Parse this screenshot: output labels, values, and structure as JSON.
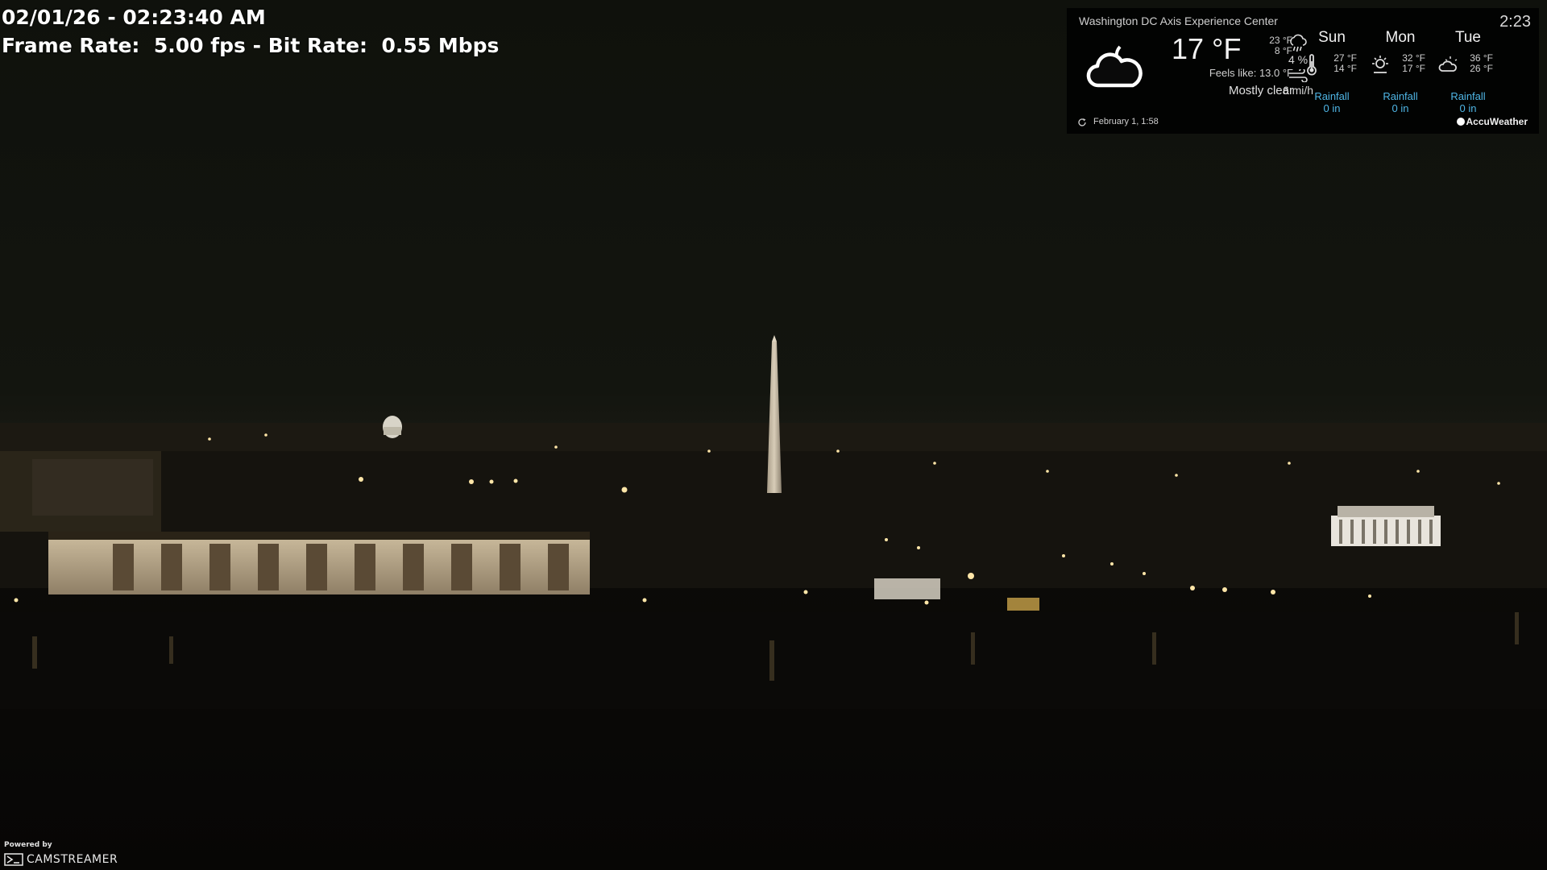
{
  "stream": {
    "datetime": "02/01/26 - 02:23:40 AM",
    "frame_rate_label": "Frame Rate:",
    "frame_rate_value": "5.00 fps",
    "bit_rate_label": "Bit Rate:",
    "bit_rate_value": "0.55 Mbps",
    "separator": "-"
  },
  "weather": {
    "location": "Washington DC Axis Experience Center",
    "time": "2:23",
    "current_icon": "partly-cloudy-night-icon",
    "temperature": "17 °F",
    "high": "23 °F",
    "low": "8 °F",
    "feels_like": "Feels like: 13.0 °F",
    "condition": "Mostly clear",
    "precip_icon": "rain-cloud-icon",
    "precipitation": "4 %",
    "wind_icon": "wind-icon",
    "wind": "6 mi/h",
    "forecast": [
      {
        "day": "Sun",
        "icon": "thermometer-icon",
        "high": "27 °F",
        "low": "14 °F",
        "rain_label": "Rainfall",
        "rain": "0 in"
      },
      {
        "day": "Mon",
        "icon": "sun-cloud-icon",
        "high": "32 °F",
        "low": "17 °F",
        "rain_label": "Rainfall",
        "rain": "0 in"
      },
      {
        "day": "Tue",
        "icon": "cloudy-sun-icon",
        "high": "36 °F",
        "low": "26 °F",
        "rain_label": "Rainfall",
        "rain": "0 in"
      }
    ],
    "updated_icon": "refresh-icon",
    "updated": "February 1, 1:58",
    "brand": "AccuWeather",
    "accent_color": "#4fb6e6"
  },
  "branding": {
    "powered_by": "Powered by",
    "name": "CAMSTREAMER",
    "logo_icon": "camstreamer-logo-icon"
  }
}
